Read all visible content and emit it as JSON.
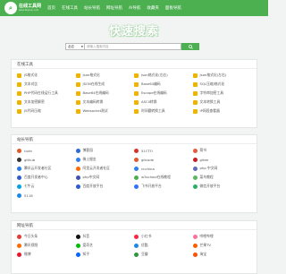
{
  "header": {
    "logo_title": "在线工具网",
    "logo_subtitle": "www.bbybun.com",
    "nav": [
      "首页",
      "在线工具",
      "站长导航",
      "网址导航",
      "AI导航",
      "收藏夹",
      "面板导航"
    ]
  },
  "hero": {
    "title": "快速搜索",
    "select_value": "必应",
    "search_placeholder": "请输入搜索内容"
  },
  "sections": [
    {
      "title": "在线工具",
      "items": [
        {
          "label": "JS格式化",
          "color": "#f0b400"
        },
        {
          "label": "Json格式化",
          "color": "#f0b400"
        },
        {
          "label": "Json格式化(左右)",
          "color": "#f0b400"
        },
        {
          "label": "Json格式化(左右)",
          "color": "#f0b400"
        },
        {
          "label": "文本对比",
          "color": "#f0b400"
        },
        {
          "label": "JSON在线生成",
          "color": "#f0b400"
        },
        {
          "label": "Base64编码",
          "color": "#f0b400"
        },
        {
          "label": "SQL压缩/格式化",
          "color": "#f0b400"
        },
        {
          "label": "PHP代码在线运行工具",
          "color": "#f0b400"
        },
        {
          "label": "Base64在线编码",
          "color": "#f0b400"
        },
        {
          "label": "Escape在线编码",
          "color": "#f0b400"
        },
        {
          "label": "字符串加密工具",
          "color": "#f0b400"
        },
        {
          "label": "文本加密解密",
          "color": "#f0b400"
        },
        {
          "label": "文本编码转换",
          "color": "#f0b400"
        },
        {
          "label": "ASCII转换",
          "color": "#f0b400"
        },
        {
          "label": "文本转换工具",
          "color": "#f0b400"
        },
        {
          "label": "JS代码压缩",
          "color": "#f0b400"
        },
        {
          "label": "Websocket测试",
          "color": "#f0b400"
        },
        {
          "label": "时间戳转换工具",
          "color": "#f0b400"
        },
        {
          "label": "IP网段查看器",
          "color": "#f0b400"
        }
      ]
    },
    {
      "title": "站长导航",
      "items": [
        {
          "label": "csdn",
          "color": "#e05a2b"
        },
        {
          "label": "博客园",
          "color": "#2c6bd1"
        },
        {
          "label": "51CTO",
          "color": "#d6342a"
        },
        {
          "label": "简书",
          "color": "#e9583f"
        },
        {
          "label": "github",
          "color": "#333333"
        },
        {
          "label": "稀土掘金",
          "color": "#2f80ed"
        },
        {
          "label": "gitcode",
          "color": "#e05a2b"
        },
        {
          "label": "gitee",
          "color": "#c71d23"
        },
        {
          "label": "腾讯云开发者社区",
          "color": "#2a7ae2"
        },
        {
          "label": "阿里云开发者社区",
          "color": "#ff6a00"
        },
        {
          "label": "cnchina",
          "color": "#2f80ed"
        },
        {
          "label": "php 中文网",
          "color": "#5c6bc0"
        },
        {
          "label": "百度开发者中心",
          "color": "#2f5bd1"
        },
        {
          "label": "php中文网",
          "color": "#3f51b5"
        },
        {
          "label": "w3school在线教程",
          "color": "#4caf50"
        },
        {
          "label": "菜鸟教程",
          "color": "#5cb85c"
        },
        {
          "label": "七牛云",
          "color": "#00a4e4"
        },
        {
          "label": "百度开放平台",
          "color": "#2f5bd1"
        },
        {
          "label": "飞书开放平台",
          "color": "#3370ff"
        },
        {
          "label": "微信开放平台",
          "color": "#2aae67"
        },
        {
          "label": "5118",
          "color": "#1e88e5"
        }
      ]
    },
    {
      "title": "网址导航",
      "items": [
        {
          "label": "今日头条",
          "color": "#e53935"
        },
        {
          "label": "抖音",
          "color": "#111111"
        },
        {
          "label": "小红书",
          "color": "#ff2442"
        },
        {
          "label": "哔哩哔哩",
          "color": "#fb7299"
        },
        {
          "label": "腾讯视频",
          "color": "#ff6a00"
        },
        {
          "label": "爱奇艺",
          "color": "#00be06"
        },
        {
          "label": "优酷",
          "color": "#1e88e5"
        },
        {
          "label": "芒果TV",
          "color": "#ff5f00"
        },
        {
          "label": "微博",
          "color": "#e6162d"
        },
        {
          "label": "知乎",
          "color": "#0066ff"
        },
        {
          "label": "豆瓣",
          "color": "#2e963d"
        },
        {
          "label": "淘宝",
          "color": "#ff5000"
        }
      ]
    }
  ]
}
